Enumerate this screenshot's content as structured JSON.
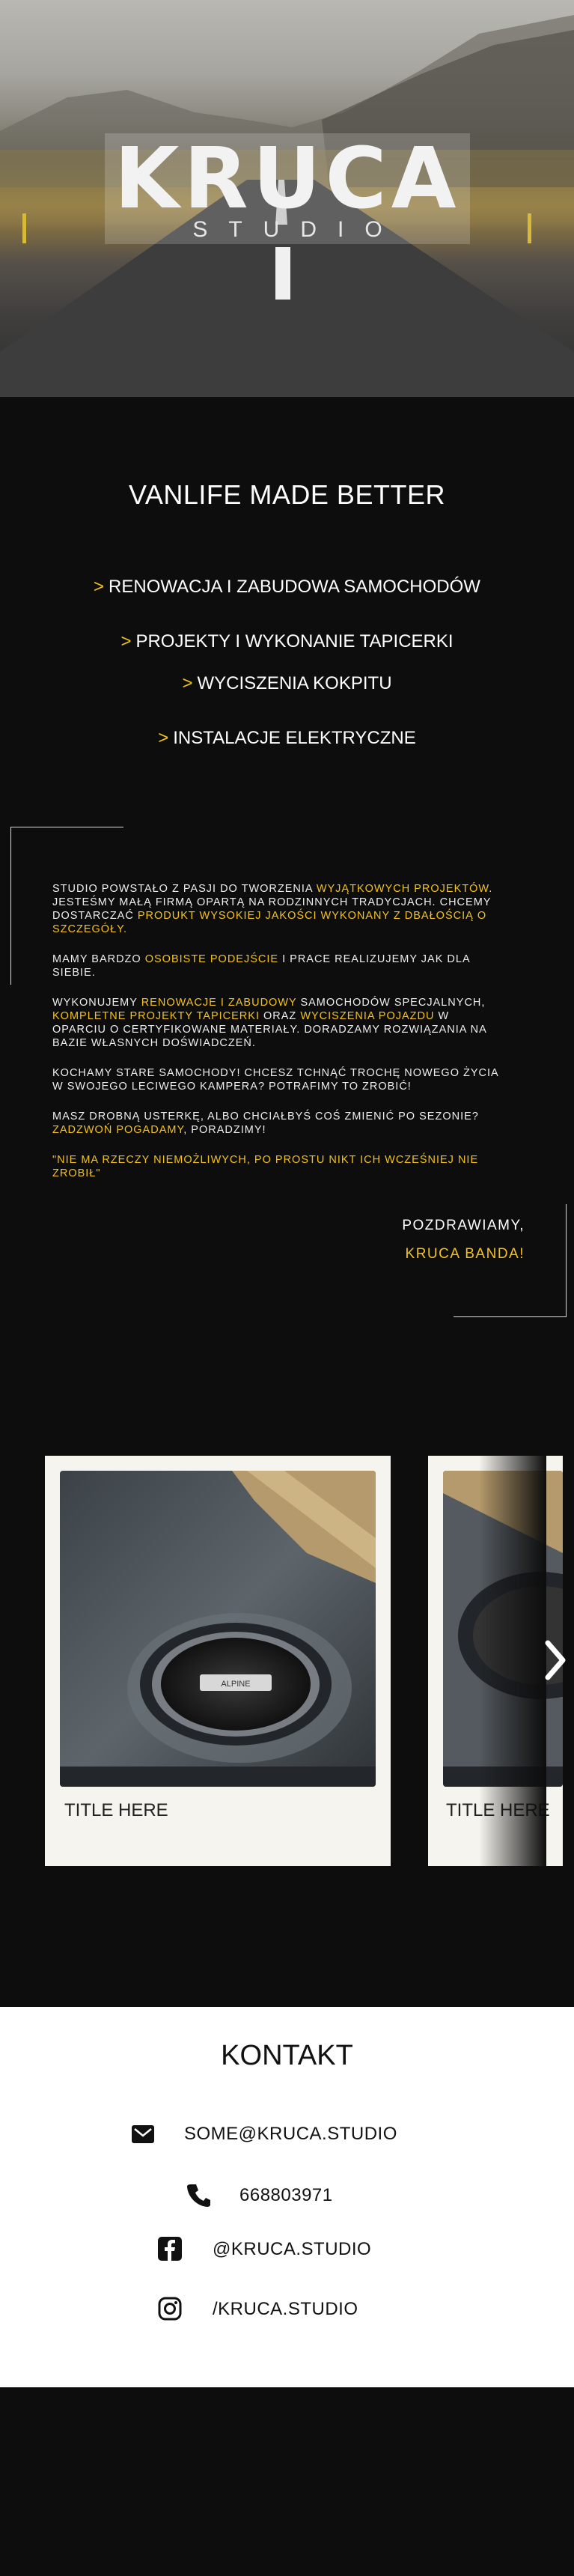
{
  "hero": {
    "logo_main": "KRUCA",
    "logo_sub": "STUDIO"
  },
  "headline": "VANLIFE MADE BETTER",
  "services": {
    "arrow": ">",
    "items": [
      "RENOWACJA I ZABUDOWA SAMOCHODÓW",
      "PROJEKTY I WYKONANIE TAPICERKI",
      "WYCISZENIA KOKPITU",
      "INSTALACJE ELEKTRYCZNE"
    ]
  },
  "about": {
    "p1_a": "STUDIO POWSTAŁO Z PASJI DO TWORZENIA ",
    "p1_b": "WYJĄTKOWYCH PROJEKTÓW",
    "p1_c": ". JESTEŚMY MAŁĄ FIRMĄ OPARTĄ NA RODZINNYCH TRADYCJACH. CHCEMY DOSTARCZAĆ ",
    "p1_d": "PRODUKT WYSOKIEJ JAKOŚCI WYKONANY Z DBAŁOŚCIĄ O SZCZEGÓŁY.",
    "p2_a": "MAMY BARDZO ",
    "p2_b": "OSOBISTE PODEJŚCIE",
    "p2_c": " I PRACE REALIZUJEMY JAK DLA SIEBIE.",
    "p3_a": "WYKONUJEMY ",
    "p3_b": "RENOWACJE I ZABUDOWY",
    "p3_c": " SAMOCHODÓW SPECJALNYCH, ",
    "p3_d": "KOMPLETNE PROJEKTY TAPICERKI",
    "p3_e": " ORAZ ",
    "p3_f": "WYCISZENIA POJAZDU",
    "p3_g": " W OPARCIU O CERTYFIKOWANE MATERIAŁY. DORADZAMY ROZWIĄZANIA NA BAZIE WŁASNYCH DOŚWIADCZEŃ.",
    "p4": "KOCHAMY STARE SAMOCHODY! CHCESZ TCHNĄĆ TROCHĘ NOWEGO ŻYCIA W SWOJEGO LECIWEGO KAMPERA? POTRAFIMY TO ZROBIĆ!",
    "p5_a": "MASZ DROBNĄ USTERKĘ, ALBO CHCIAŁBYŚ COŚ ZMIENIĆ PO SEZONIE? ",
    "p5_b": "ZADZWOŃ POGADAMY",
    "p5_c": ", PORADZIMY!",
    "p6": "\"NIE MA RZECZY NIEMOŻLIWYCH, PO PROSTU NIKT ICH WCZEŚNIEJ NIE ZROBIŁ\""
  },
  "sign": {
    "greeting": "POZDRAWIAMY,",
    "team": "KRUCA BANDA!"
  },
  "gallery": {
    "cards": [
      {
        "title": "TITLE HERE",
        "badge": "ALPINE"
      },
      {
        "title": "TITLE HERE"
      }
    ]
  },
  "contact": {
    "title": "KONTAKT",
    "email": "SOME@KRUCA.STUDIO",
    "phone": "668803971",
    "facebook": "@KRUCA.STUDIO",
    "instagram": "/KRUCA.STUDIO"
  },
  "colors": {
    "accent": "#f4c21b",
    "background": "#0d0d0d",
    "contact_bg": "#ffffff"
  },
  "icons": [
    "email-icon",
    "phone-icon",
    "facebook-icon",
    "instagram-icon",
    "chevron-right-icon"
  ]
}
